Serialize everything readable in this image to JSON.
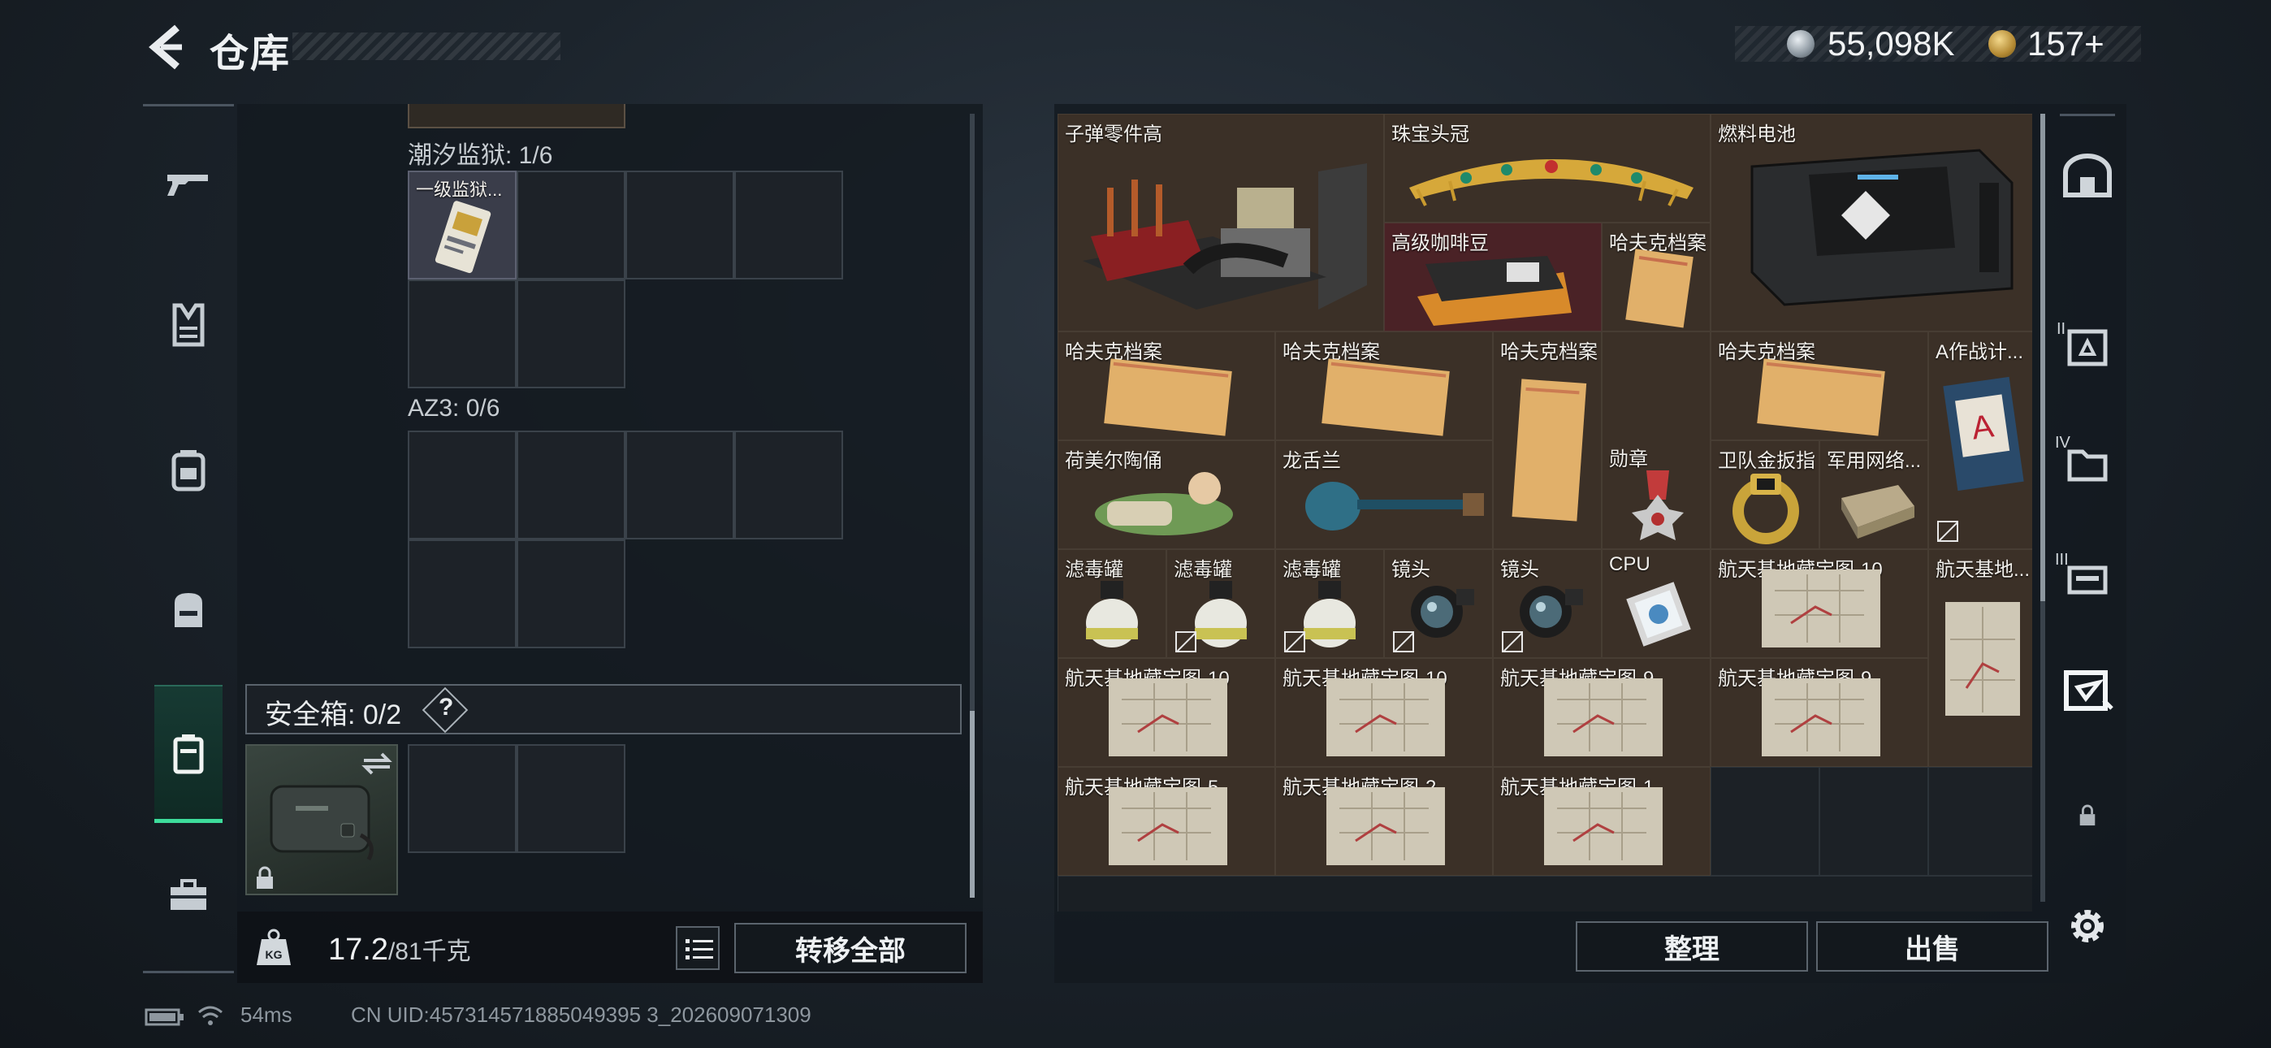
{
  "header": {
    "title": "仓库",
    "currency1": "55,098K",
    "currency2": "157+"
  },
  "left_nav": [
    "rifle-icon",
    "vest-icon",
    "backpack-icon",
    "bag-icon",
    "case-icon",
    "toolbox-icon"
  ],
  "sections": {
    "prison_label": "潮汐监狱: 1/6",
    "prison_item": "一级监狱...",
    "az3_label": "AZ3: 0/6"
  },
  "safe": {
    "label": "安全箱: 0/2",
    "help": "?"
  },
  "footer": {
    "weight": "17.2",
    "weight_max": "/81千克",
    "transfer_all": "转移全部"
  },
  "stash_items": [
    {
      "label": "子弹零件高",
      "color": "#3b3027"
    },
    {
      "label": "珠宝头冠",
      "color": "#3b3027"
    },
    {
      "label": "燃料电池",
      "color": "#3b3027"
    },
    {
      "label": "高级咖啡豆",
      "color": "#4a2226"
    },
    {
      "label": "哈夫克档案",
      "color": "#3b3027"
    },
    {
      "label": "哈夫克档案"
    },
    {
      "label": "哈夫克档案"
    },
    {
      "label": "哈夫克档案"
    },
    {
      "label": "哈夫克档案"
    },
    {
      "label": "A作战计..."
    },
    {
      "label": "荷美尔陶俑"
    },
    {
      "label": "龙舌兰"
    },
    {
      "label": "勋章"
    },
    {
      "label": "卫队金扳指"
    },
    {
      "label": "军用网络..."
    },
    {
      "label": "滤毒罐"
    },
    {
      "label": "滤毒罐"
    },
    {
      "label": "滤毒罐"
    },
    {
      "label": "镜头"
    },
    {
      "label": "镜头"
    },
    {
      "label": "CPU"
    },
    {
      "label": "航天基地藏宝图-10"
    },
    {
      "label": "航天基地..."
    },
    {
      "label": "航天基地藏宝图-10"
    },
    {
      "label": "航天基地藏宝图-10"
    },
    {
      "label": "航天基地藏宝图-9"
    },
    {
      "label": "航天基地藏宝图-9"
    },
    {
      "label": "航天基地藏宝图-5"
    },
    {
      "label": "航天基地藏宝图-2"
    },
    {
      "label": "航天基地藏宝图-1"
    }
  ],
  "right_actions": {
    "sort": "整理",
    "sell": "出售"
  },
  "right_nav": {
    "roman2": "II",
    "roman4": "IV",
    "roman3": "III"
  },
  "status_bar": {
    "ping": "54ms",
    "uid": "CN UID:457314571885049395 3_202609071309"
  }
}
